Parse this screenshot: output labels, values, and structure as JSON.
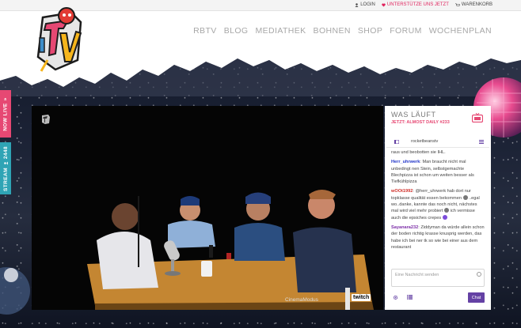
{
  "topbar": {
    "login": "LOGIN",
    "support": "UNTERSTÜTZE UNS JETZT",
    "cart": "WARENKORB"
  },
  "nav": {
    "items": [
      "RBTV",
      "BLOG",
      "MEDIATHEK",
      "BOHNEN",
      "SHOP",
      "FORUM",
      "WOCHENPLAN"
    ]
  },
  "side": {
    "live_label": "NOW LIVE",
    "stream_label": "STREAM",
    "viewer_count": "2448"
  },
  "player": {
    "mode_label": "CinemaModus",
    "brand": "twitch"
  },
  "panel": {
    "title": "WAS LÄUFT",
    "now_playing": "JETZT: ALMOST DAILY #233",
    "chat": {
      "channel": "rocketbeanstv",
      "messages": [
        {
          "user": "",
          "text": "raus und beobotten sie IHL.",
          "color": "#444444"
        },
        {
          "user": "Herr_uhrwerk",
          "text": "Man braucht nicht mal unbedingt nen Stein, selbstgemachte Blechpizza ist schon um weiten besser als Tiefkühlpizza",
          "color": "#1f33c8"
        },
        {
          "user": "wOOt1992",
          "text": "@herr_uhrwerk hab dort nur topklasse qualität essen bekommen",
          "text2": "..egal wo..danke, kannte das noch nicht, nächstes mal wird viel mehr probiert",
          "text3": "ich vermisse auch die epsiches crepes",
          "color": "#d0302a"
        },
        {
          "user": "Sayanara232",
          "text": "Ziddyman da würde allein schon der boden richtig krasse knusprig werden, das habe ich bei ner tk so wie bei einer aus dem restaurant",
          "color": "#7d2fa8"
        }
      ],
      "input_placeholder": "Eine Nachricht senden",
      "send_label": "Chat"
    }
  },
  "colors": {
    "accent_pink": "#e64873",
    "accent_teal": "#2fa4b5",
    "twitch_purple": "#6441a4"
  }
}
